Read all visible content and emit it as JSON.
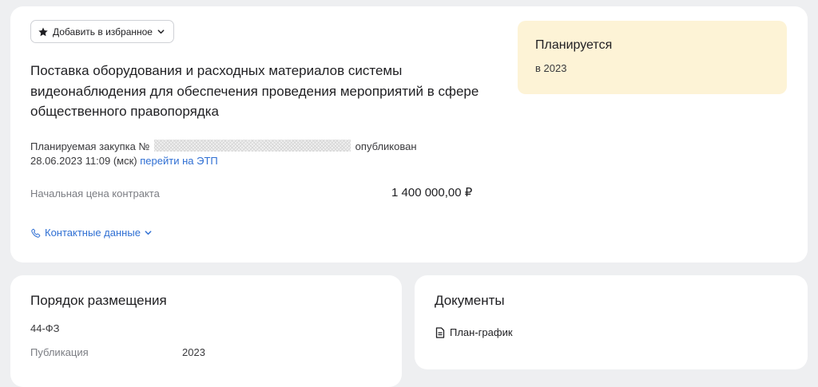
{
  "favorites": {
    "label": "Добавить в избранное",
    "icon": "star-icon"
  },
  "purchase": {
    "title": "Поставка оборудования и расходных материалов системы видеонаблюдения для обеспечения проведения мероприятий в сфере общественного правопорядка",
    "number_prefix": "Планируемая закупка №",
    "published_word": "опубликован",
    "published_at": "28.06.2023 11:09 (мск)",
    "etp_link": "перейти на ЭТП",
    "price_label": "Начальная цена контракта",
    "price_value": "1 400 000,00 ₽",
    "contacts_label": "Контактные данные"
  },
  "status": {
    "title": "Планируется",
    "subtitle": "в 2023",
    "color": "#fdf3d6"
  },
  "order": {
    "title": "Порядок размещения",
    "law": "44-ФЗ",
    "publication_label": "Публикация",
    "publication_value": "2023"
  },
  "documents": {
    "title": "Документы",
    "items": [
      {
        "label": "План-график",
        "icon": "document-icon"
      }
    ]
  },
  "colors": {
    "link": "#2f6fd3",
    "background": "#eeeff1"
  }
}
